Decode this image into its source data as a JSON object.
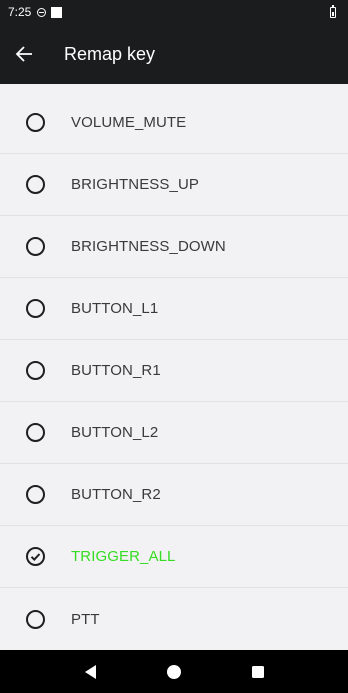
{
  "status_bar": {
    "time": "7:25"
  },
  "app_bar": {
    "title": "Remap key"
  },
  "options": [
    {
      "label": "VOLUME_MUTE",
      "selected": false
    },
    {
      "label": "BRIGHTNESS_UP",
      "selected": false
    },
    {
      "label": "BRIGHTNESS_DOWN",
      "selected": false
    },
    {
      "label": "BUTTON_L1",
      "selected": false
    },
    {
      "label": "BUTTON_R1",
      "selected": false
    },
    {
      "label": "BUTTON_L2",
      "selected": false
    },
    {
      "label": "BUTTON_R2",
      "selected": false
    },
    {
      "label": "TRIGGER_ALL",
      "selected": true
    },
    {
      "label": "PTT",
      "selected": false
    }
  ],
  "colors": {
    "selected_text": "#33dd22",
    "bar_background": "#1b1c1e",
    "list_background": "#f2f1f3"
  },
  "icons": [
    "back-arrow-icon",
    "nav-back-icon",
    "nav-home-icon",
    "nav-recents-icon"
  ]
}
